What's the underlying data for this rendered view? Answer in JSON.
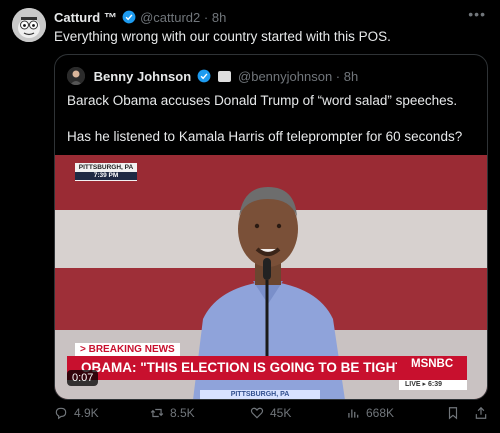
{
  "post": {
    "author": {
      "name": "Catturd ™",
      "handle": "@catturd2",
      "time": "8h"
    },
    "text": "Everything wrong with our country started with this POS.",
    "more_icon": "more-icon",
    "verified_color": "#1d9bf0"
  },
  "quote": {
    "author": {
      "name": "Benny Johnson",
      "handle": "@bennyjohnson",
      "time": "8h"
    },
    "paragraphs": [
      "Barack Obama accuses Donald Trump of “word salad” speeches.",
      "Has he listened to Kamala Harris off teleprompter for 60 seconds?"
    ],
    "video": {
      "location": "PITTSBURGH, PA",
      "location_time": "7:39 PM",
      "breaking_label": "> BREAKING NEWS",
      "headline": "OBAMA: \"THIS ELECTION IS GOING TO BE TIGHT\"",
      "network": "MSNBC",
      "live_label": "LIVE",
      "live_time": "6:39",
      "subline": "PITTSBURGH, PA",
      "duration": "0:07"
    }
  },
  "actions": {
    "replies": "4.9K",
    "reposts": "8.5K",
    "likes": "45K",
    "views": "668K"
  }
}
